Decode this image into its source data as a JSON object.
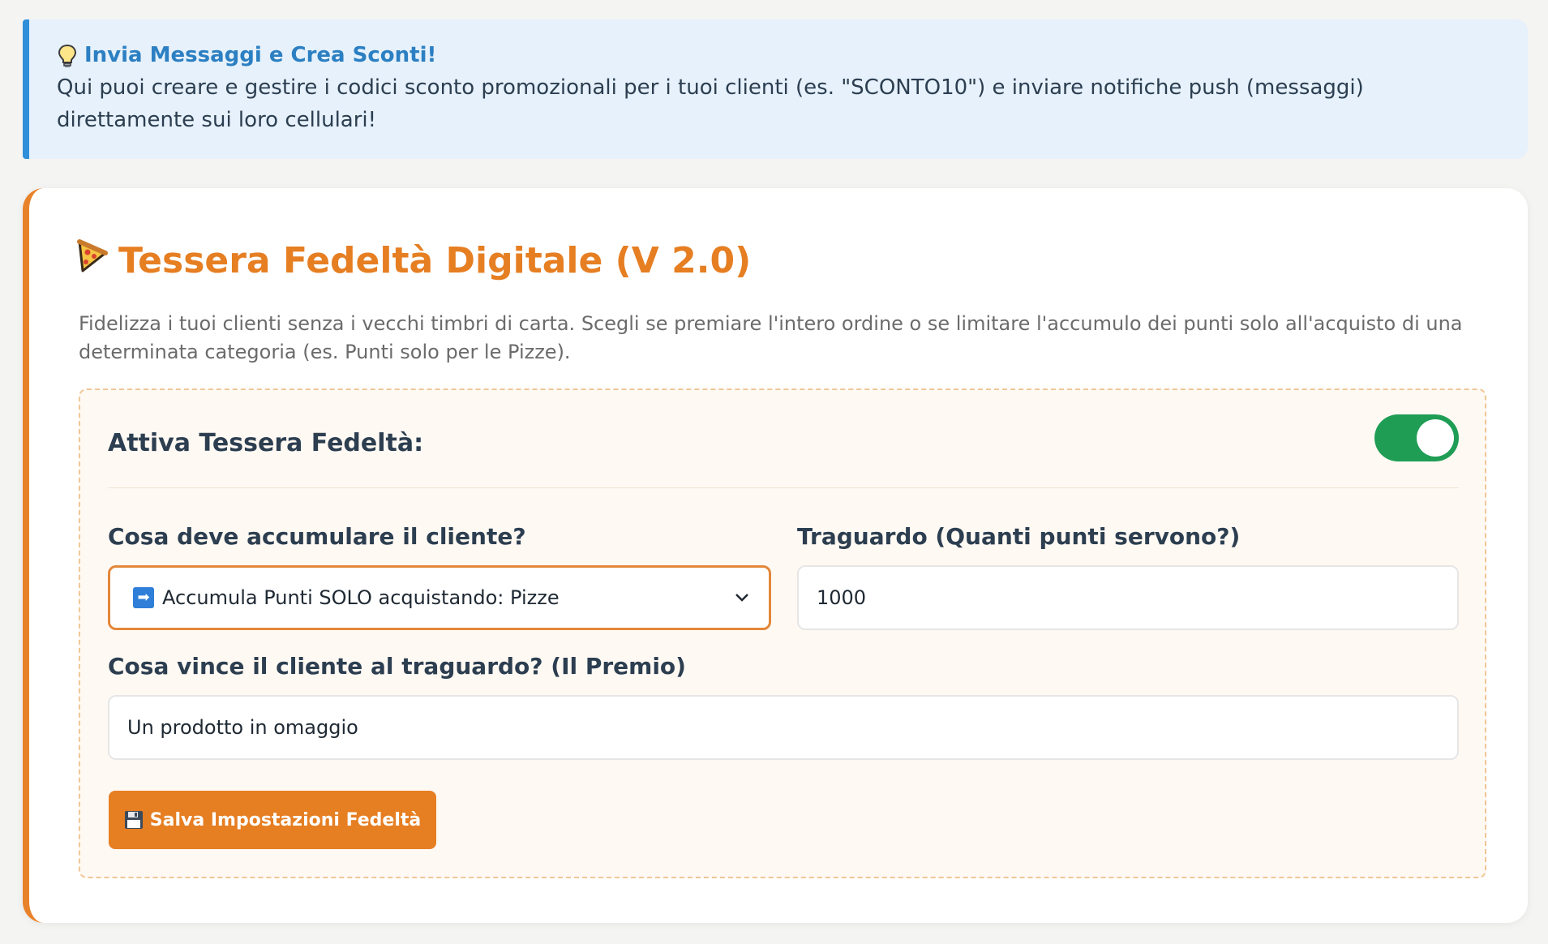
{
  "info": {
    "title": "Invia Messaggi e Crea Sconti!",
    "text": "Qui puoi creare e gestire i codici sconto promozionali per i tuoi clienti (es. \"SCONTO10\") e inviare notifiche push (messaggi) direttamente sui loro cellulari!",
    "icon": "lightbulb-icon",
    "accent": "#2f8fd8"
  },
  "card": {
    "title": "Tessera Fedeltà Digitale (V 2.0)",
    "icon": "pizza-icon",
    "description": "Fidelizza i tuoi clienti senza i vecchi timbri di carta. Scegli se premiare l'intero ordine o se limitare l'accumulo dei punti solo all'acquisto di una determinata categoria (es. Punti solo per le Pizze).",
    "accent": "#e67e22"
  },
  "loyalty": {
    "toggle_label": "Attiva Tessera Fedeltà:",
    "enabled": true,
    "toggle_color": "#1f9d55",
    "accumulate_label": "Cosa deve accumulare il cliente?",
    "accumulate_value": "Accumula Punti SOLO acquistando: Pizze",
    "accumulate_icon": "right-arrow-icon",
    "goal_label": "Traguardo (Quanti punti servono?)",
    "goal_value": "1000",
    "prize_label": "Cosa vince il cliente al traguardo? (Il Premio)",
    "prize_value": "Un prodotto in omaggio",
    "save_label": "Salva Impostazioni Fedeltà",
    "save_icon": "floppy-disk-icon"
  }
}
